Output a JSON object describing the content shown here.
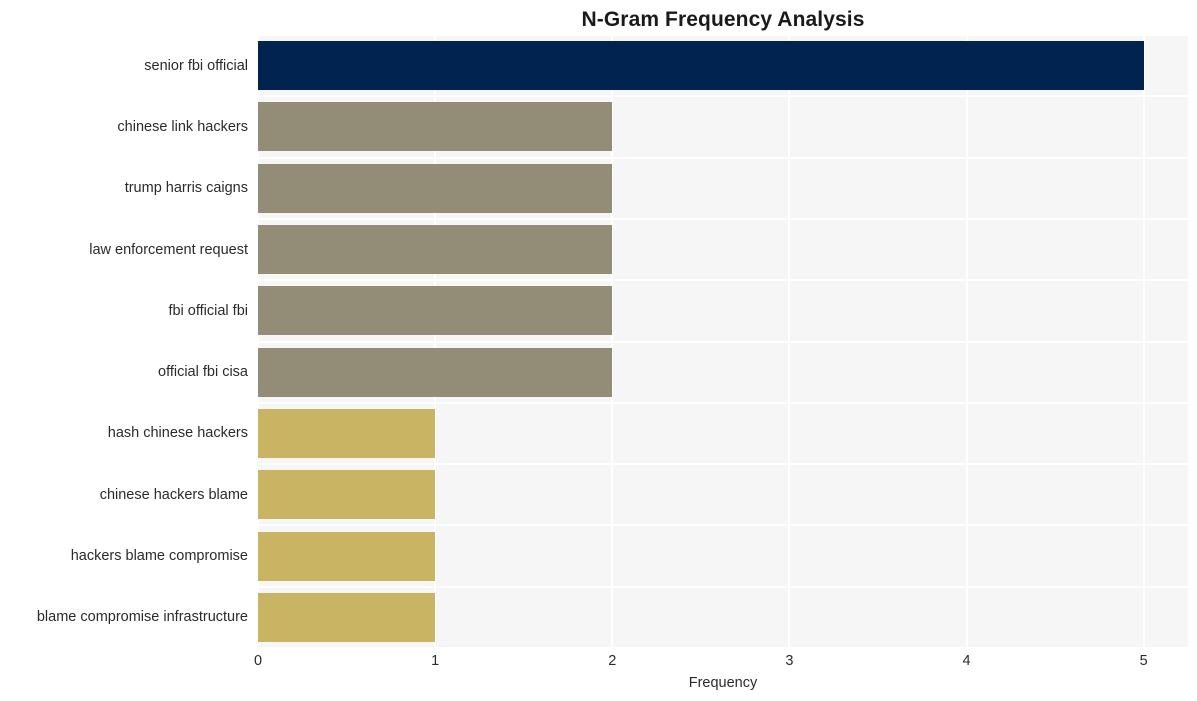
{
  "chart_data": {
    "type": "bar",
    "orientation": "horizontal",
    "title": "N-Gram Frequency Analysis",
    "xlabel": "Frequency",
    "ylabel": "",
    "xlim": [
      0,
      5.25
    ],
    "xticks": [
      "0",
      "1",
      "2",
      "3",
      "4",
      "5"
    ],
    "xtick_values": [
      0,
      1,
      2,
      3,
      4,
      5
    ],
    "grid": true,
    "legend": "none",
    "categories": [
      "senior fbi official",
      "chinese link hackers",
      "trump harris caigns",
      "law enforcement request",
      "fbi official fbi",
      "official fbi cisa",
      "hash chinese hackers",
      "chinese hackers blame",
      "hackers blame compromise",
      "blame compromise infrastructure"
    ],
    "values": [
      5,
      2,
      2,
      2,
      2,
      2,
      1,
      1,
      1,
      1
    ],
    "bar_colors": [
      "#002350",
      "#938c76",
      "#938c76",
      "#938c76",
      "#938c76",
      "#938c76",
      "#c9b464",
      "#c9b464",
      "#c9b464",
      "#c9b464"
    ]
  },
  "style": {
    "figure_background": "#ffffff",
    "plot_background": "#f6f6f6",
    "gridline_color": "#ffffff",
    "text_color": "#2b2b2b",
    "title_color": "#1a1a1a"
  }
}
